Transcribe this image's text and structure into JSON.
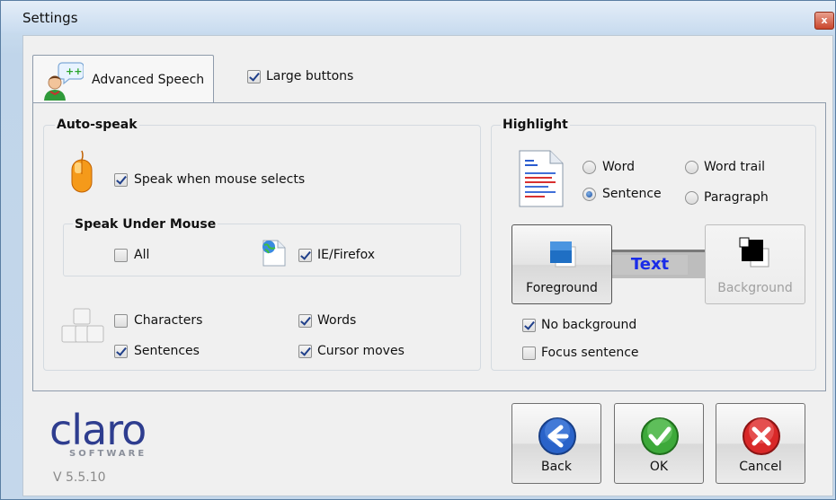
{
  "window": {
    "title": "Settings",
    "close_symbol": "x"
  },
  "tabs": {
    "active_label": "Advanced Speech"
  },
  "options": {
    "large_buttons": {
      "label": "Large buttons",
      "checked": true
    }
  },
  "auto_speak": {
    "title": "Auto-speak",
    "speak_mouse_selects": {
      "label": "Speak when mouse selects",
      "checked": true
    },
    "speak_under_mouse": {
      "title": "Speak Under Mouse",
      "all": {
        "label": "All",
        "checked": false
      },
      "ie_firefox": {
        "label": "IE/Firefox",
        "checked": true
      }
    },
    "characters": {
      "label": "Characters",
      "checked": false
    },
    "words": {
      "label": "Words",
      "checked": true
    },
    "sentences": {
      "label": "Sentences",
      "checked": true
    },
    "cursor_moves": {
      "label": "Cursor moves",
      "checked": true
    }
  },
  "highlight": {
    "title": "Highlight",
    "radios": {
      "word": {
        "label": "Word",
        "selected": false
      },
      "word_trail": {
        "label": "Word trail",
        "selected": false
      },
      "sentence": {
        "label": "Sentence",
        "selected": true
      },
      "paragraph": {
        "label": "Paragraph",
        "selected": false
      }
    },
    "foreground_label": "Foreground",
    "background_label": "Background",
    "sample_text": "Text",
    "sample_text_color": "#1a2ce8",
    "no_background": {
      "label": "No background",
      "checked": true
    },
    "focus_sentence": {
      "label": "Focus sentence",
      "checked": false
    }
  },
  "footer": {
    "logo_main": "claro",
    "logo_sub": "SOFTWARE",
    "version": "V 5.5.10",
    "back_label": "Back",
    "ok_label": "OK",
    "cancel_label": "Cancel"
  }
}
